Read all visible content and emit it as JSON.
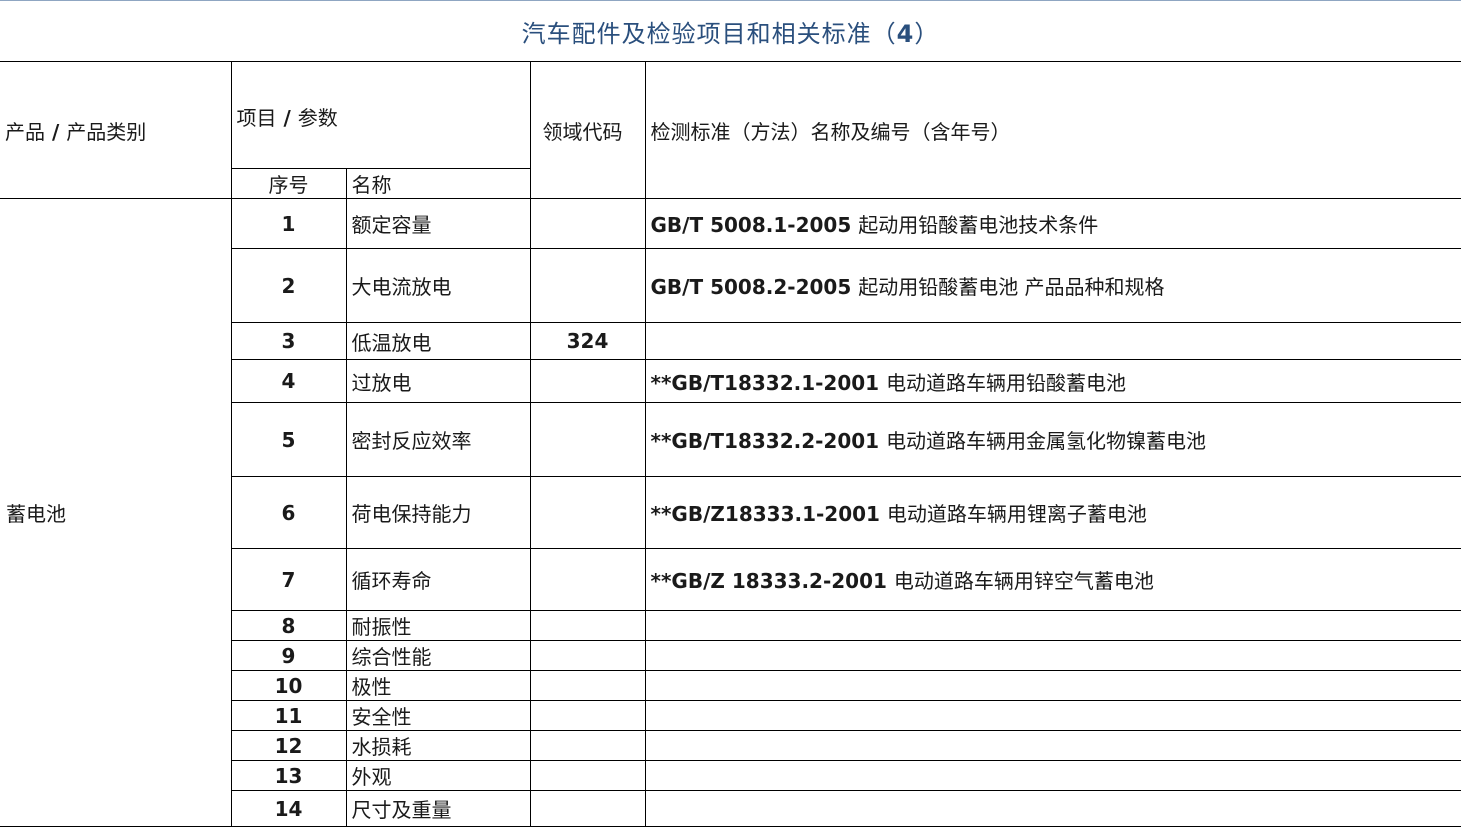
{
  "title": {
    "text": "汽车配件及检验项目和相关标准（",
    "num": "4",
    "close": "）"
  },
  "headers": {
    "product_a": "产品",
    "product_sep": " / ",
    "product_b": "产品类别",
    "item_a": "项目",
    "item_sep": " / ",
    "item_b": "参数",
    "seq": "序号",
    "name": "名称",
    "code": "领域代码",
    "standard": "检测标准（方法）名称及编号（含年号）"
  },
  "category": "蓄电池",
  "rows": [
    {
      "seq": "1",
      "name": "额定容量",
      "code": "",
      "std_code": "GB/T 5008.1-2005 ",
      "std_title": "起动用铅酸蓄电池技术条件"
    },
    {
      "seq": "2",
      "name": "大电流放电",
      "code": "",
      "std_code": "GB/T 5008.2-2005 ",
      "std_title": "起动用铅酸蓄电池 产品品种和规格"
    },
    {
      "seq": "3",
      "name": "低温放电",
      "code": "324",
      "std_code": "",
      "std_title": ""
    },
    {
      "seq": "4",
      "name": "过放电",
      "code": "",
      "std_code": "**GB/T18332.1-2001 ",
      "std_title": "电动道路车辆用铅酸蓄电池"
    },
    {
      "seq": "5",
      "name": "密封反应效率",
      "code": "",
      "std_code": "**GB/T18332.2-2001 ",
      "std_title": "电动道路车辆用金属氢化物镍蓄电池"
    },
    {
      "seq": "6",
      "name": "荷电保持能力",
      "code": "",
      "std_code": "**GB/Z18333.1-2001 ",
      "std_title": "电动道路车辆用锂离子蓄电池"
    },
    {
      "seq": "7",
      "name": "循环寿命",
      "code": "",
      "std_code": "**GB/Z 18333.2-2001 ",
      "std_title": "电动道路车辆用锌空气蓄电池"
    },
    {
      "seq": "8",
      "name": "耐振性",
      "code": "",
      "std_code": "",
      "std_title": ""
    },
    {
      "seq": "9",
      "name": "综合性能",
      "code": "",
      "std_code": "",
      "std_title": ""
    },
    {
      "seq": "10",
      "name": "极性",
      "code": "",
      "std_code": "",
      "std_title": ""
    },
    {
      "seq": "11",
      "name": "安全性",
      "code": "",
      "std_code": "",
      "std_title": ""
    },
    {
      "seq": "12",
      "name": "水损耗",
      "code": "",
      "std_code": "",
      "std_title": ""
    },
    {
      "seq": "13",
      "name": "外观",
      "code": "",
      "std_code": "",
      "std_title": ""
    },
    {
      "seq": "14",
      "name": "尺寸及重量",
      "code": "",
      "std_code": "",
      "std_title": ""
    }
  ]
}
